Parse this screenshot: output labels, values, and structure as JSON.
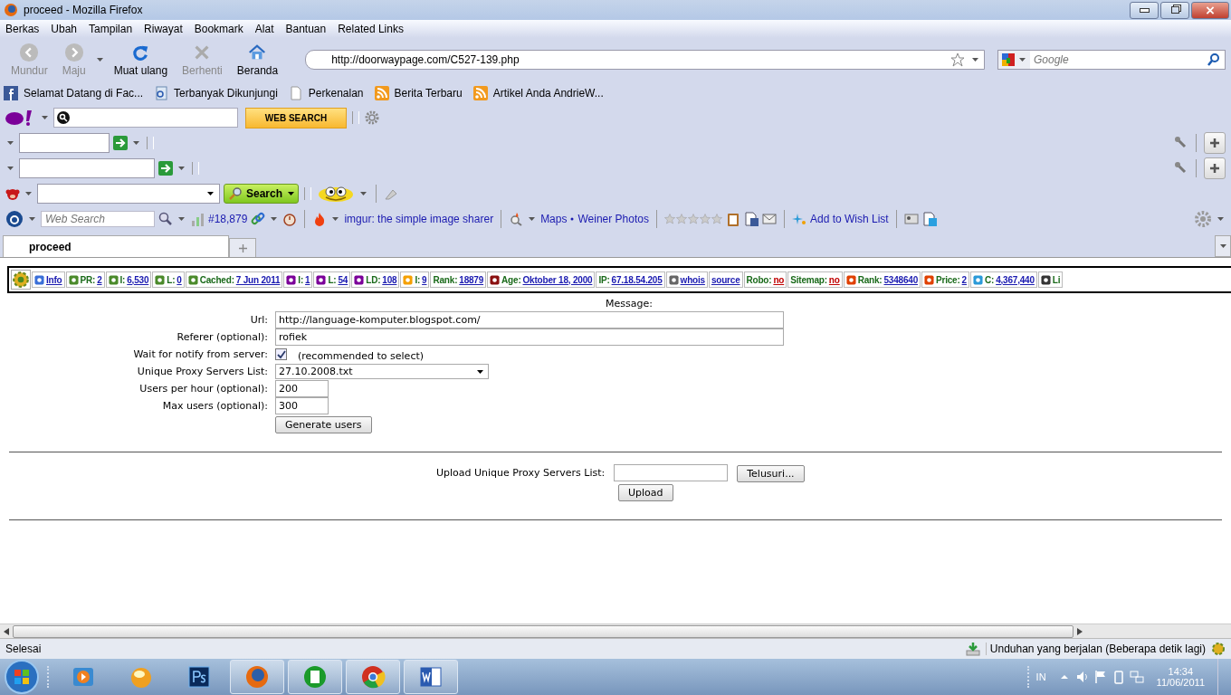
{
  "window": {
    "title": "proceed - Mozilla Firefox"
  },
  "menu": [
    "Berkas",
    "Ubah",
    "Tampilan",
    "Riwayat",
    "Bookmark",
    "Alat",
    "Bantuan",
    "Related Links"
  ],
  "nav_buttons": [
    {
      "label": "Mundur",
      "disabled": true
    },
    {
      "label": "Maju",
      "disabled": true
    },
    {
      "label": "Muat ulang",
      "disabled": false
    },
    {
      "label": "Berhenti",
      "disabled": true
    },
    {
      "label": "Beranda",
      "disabled": false
    }
  ],
  "address": {
    "value": "http://doorwaypage.com/C527-139.php"
  },
  "search": {
    "placeholder": "Google"
  },
  "bookmarks": [
    "Selamat Datang di Fac...",
    "Terbanyak Dikunjungi",
    "Perkenalan",
    "Berita Terbaru",
    "Artikel Anda AndrieW..."
  ],
  "yahoo_toolbar": {
    "button": "WEB SEARCH"
  },
  "search_toolbar": {
    "button": "Search"
  },
  "alexa_toolbar": {
    "placeholder": "Web Search",
    "rank": "#18,879",
    "links": [
      "imgur: the simple image sharer",
      "Maps",
      "Weiner Photos"
    ],
    "stars": 0,
    "wish": "Add to Wish List"
  },
  "tabs": [
    {
      "label": "proceed",
      "selected": true
    }
  ],
  "seo_bar": [
    {
      "value": "Info",
      "kind": "link"
    },
    {
      "label": "PR:",
      "value": "2",
      "kind": "link"
    },
    {
      "label": "I:",
      "value": "6,530",
      "kind": "link"
    },
    {
      "label": "L:",
      "value": "0",
      "kind": "link"
    },
    {
      "label": "Cached:",
      "value": "7 Jun 2011",
      "kind": "link"
    },
    {
      "label": "I:",
      "value": "1",
      "kind": "link"
    },
    {
      "label": "L:",
      "value": "54",
      "kind": "link"
    },
    {
      "label": "LD:",
      "value": "108",
      "kind": "link"
    },
    {
      "label": "I:",
      "value": "9",
      "kind": "link"
    },
    {
      "label": "Rank:",
      "value": "18879",
      "kind": "link"
    },
    {
      "label": "Age:",
      "value": "Oktober 18, 2000",
      "kind": "link"
    },
    {
      "label": "IP:",
      "value": "67.18.54.205",
      "kind": "link"
    },
    {
      "value": "whois",
      "kind": "link"
    },
    {
      "value": "source",
      "kind": "link"
    },
    {
      "label": "Robo:",
      "value": "no",
      "kind": "negative"
    },
    {
      "label": "Sitemap:",
      "value": "no",
      "kind": "negative"
    },
    {
      "label": "Rank:",
      "value": "5348640",
      "kind": "link"
    },
    {
      "label": "Price:",
      "value": "2",
      "kind": "link"
    },
    {
      "label": "C:",
      "value": "4,367,440",
      "kind": "link"
    },
    {
      "label": "Li"
    }
  ],
  "form": {
    "message_label": "Message:",
    "fields": [
      {
        "label": "Url:",
        "kind": "text",
        "value": "http://language-komputer.blogspot.com/"
      },
      {
        "label": "Referer (optional):",
        "kind": "text",
        "value": "rofiek"
      },
      {
        "label": "Wait for notify from server:",
        "kind": "checkbox",
        "checked": true,
        "value": "(recommended to select)"
      },
      {
        "label": "Unique Proxy Servers List:",
        "kind": "select",
        "value": "27.10.2008.txt"
      },
      {
        "label": "Users per hour (optional):",
        "kind": "short",
        "value": "200"
      },
      {
        "label": "Max users (optional):",
        "kind": "short",
        "value": "300"
      }
    ],
    "submit": "Generate users",
    "upload_label": "Upload Unique Proxy Servers List:",
    "browse": "Telusuri...",
    "upload": "Upload"
  },
  "status_bar": {
    "text": "Selesai",
    "downloads": "Unduhan yang berjalan (Beberapa detik lagi)"
  },
  "taskbar": {
    "apps": [
      {
        "running": false
      },
      {
        "running": false
      },
      {
        "running": false
      },
      {
        "running": true
      },
      {
        "running": true
      },
      {
        "running": true
      },
      {
        "running": true
      }
    ],
    "lang": "IN",
    "time": "14:34",
    "date": "11/06/2011"
  }
}
